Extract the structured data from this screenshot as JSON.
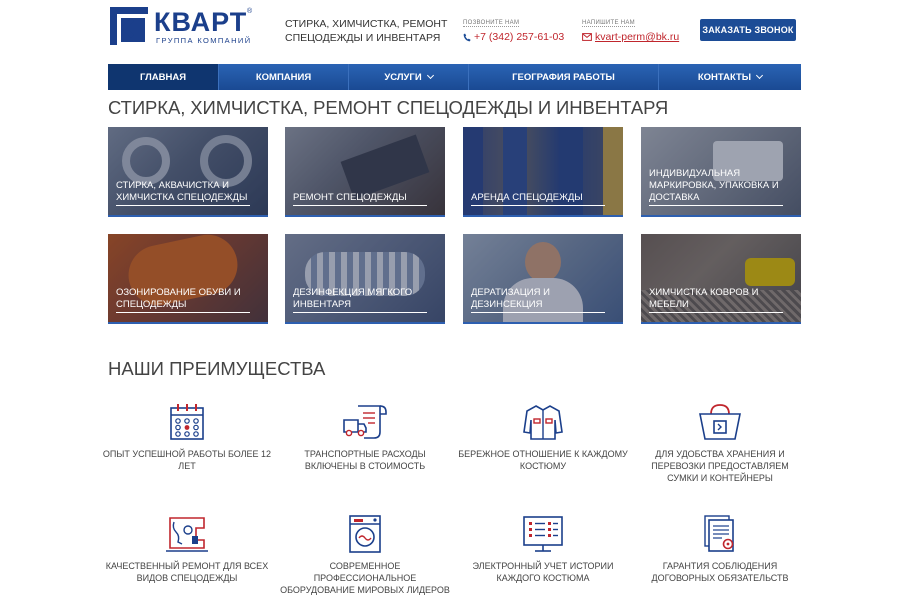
{
  "header": {
    "logo_text": "КВАРТ",
    "logo_reg": "®",
    "logo_sub": "ГРУППА КОМПАНИЙ",
    "tagline": "СТИРКА, ХИМЧИСТКА, РЕМОНТ СПЕЦОДЕЖДЫ И ИНВЕНТАРЯ",
    "phone_label": "ПОЗВОНИТЕ НАМ",
    "phone": "+7 (342) 257-61-03",
    "mail_label": "НАПИШИТЕ НАМ",
    "email": "kvart-perm@bk.ru",
    "callback_button": "ЗАКАЗАТЬ ЗВОНОК"
  },
  "nav": {
    "items": [
      {
        "label": "ГЛАВНАЯ"
      },
      {
        "label": "КОМПАНИЯ"
      },
      {
        "label": "УСЛУГИ"
      },
      {
        "label": "ГЕОГРАФИЯ РАБОТЫ"
      },
      {
        "label": "КОНТАКТЫ"
      }
    ]
  },
  "services": {
    "title": "СТИРКА, ХИМЧИСТКА, РЕМОНТ СПЕЦОДЕЖДЫ И ИНВЕНТАРЯ",
    "tiles": [
      {
        "label": "СТИРКА, АКВАЧИСТКА И ХИМЧИСТКА СПЕЦОДЕЖДЫ"
      },
      {
        "label": "РЕМОНТ СПЕЦОДЕЖДЫ"
      },
      {
        "label": "АРЕНДА СПЕЦОДЕЖДЫ"
      },
      {
        "label": "ИНДИВИДУАЛЬНАЯ МАРКИРОВКА, УПАКОВКА И ДОСТАВКА"
      },
      {
        "label": "ОЗОНИРОВАНИЕ ОБУВИ И СПЕЦОДЕЖДЫ"
      },
      {
        "label": "ДЕЗИНФЕКЦИЯ МЯГКОГО ИНВЕНТАРЯ"
      },
      {
        "label": "ДЕРАТИЗАЦИЯ И ДЕЗИНСЕКЦИЯ"
      },
      {
        "label": "ХИМЧИСТКА КОВРОВ И МЕБЕЛИ"
      }
    ]
  },
  "advantages": {
    "title": "НАШИ ПРЕИМУЩЕСТВА",
    "items": [
      {
        "text": "ОПЫТ УСПЕШНОЙ РАБОТЫ БОЛЕЕ 12 ЛЕТ",
        "icon": "calendar-icon"
      },
      {
        "text": "ТРАНСПОРТНЫЕ РАСХОДЫ ВКЛЮЧЕНЫ В СТОИМОСТЬ",
        "icon": "delivery-truck-icon"
      },
      {
        "text": "БЕРЕЖНОЕ ОТНОШЕНИЕ К КАЖДОМУ КОСТЮМУ",
        "icon": "workwear-jacket-icon"
      },
      {
        "text": "ДЛЯ УДОБСТВА ХРАНЕНИЯ И ПЕРЕВОЗКИ ПРЕДОСТАВЛЯЕМ СУМКИ И КОНТЕЙНЕРЫ",
        "icon": "branded-bag-icon"
      },
      {
        "text": "КАЧЕСТВЕННЫЙ РЕМОНТ ДЛЯ ВСЕХ ВИДОВ СПЕЦОДЕЖДЫ",
        "icon": "sewing-machine-icon"
      },
      {
        "text": "СОВРЕМЕННОЕ ПРОФЕССИОНАЛЬНОЕ ОБОРУДОВАНИЕ МИРОВЫХ ЛИДЕРОВ",
        "icon": "washing-machine-icon"
      },
      {
        "text": "ЭЛЕКТРОННЫЙ УЧЕТ ИСТОРИИ КАЖДОГО КОСТЮМА",
        "icon": "monitor-list-icon"
      },
      {
        "text": "ГАРАНТИЯ СОБЛЮДЕНИЯ ДОГОВОРНЫХ ОБЯЗАТЕЛЬСТВ",
        "icon": "contract-document-icon"
      }
    ]
  },
  "colors": {
    "brand_blue": "#1b3f8b",
    "nav_blue": "#1a4a93",
    "accent_red": "#c0262d"
  }
}
